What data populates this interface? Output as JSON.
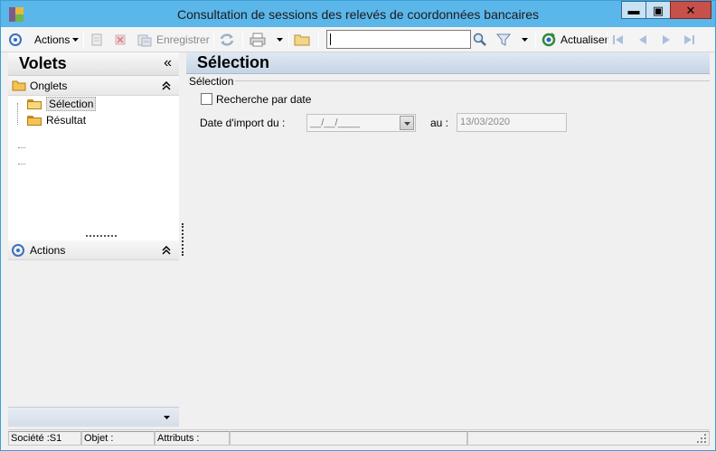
{
  "window": {
    "title": "Consultation de sessions des relevés de coordonnées bancaires",
    "minimize_glyph": "▬",
    "maximize_glyph": "▣",
    "close_glyph": "✕"
  },
  "toolbar": {
    "actions_label": "Actions",
    "save_label": "Enregistrer",
    "refresh_label": "Actualiser",
    "search_value": ""
  },
  "left_panel": {
    "title": "Volets",
    "collapse_glyph": "«",
    "tabs_section": {
      "label": "Onglets",
      "items": [
        {
          "label": "Sélection",
          "selected": true
        },
        {
          "label": "Résultat",
          "selected": false
        }
      ]
    },
    "actions_section": {
      "label": "Actions"
    }
  },
  "main": {
    "title": "Sélection",
    "group_label": "Sélection",
    "search_by_date_label": "Recherche par date",
    "search_by_date_checked": false,
    "import_date_label": "Date d'import du :",
    "import_date_from": "__/__/____",
    "to_label": "au :",
    "import_date_to": "13/03/2020"
  },
  "statusbar": {
    "company": "Société :S1",
    "object": "Objet :",
    "attributes": "Attributs :"
  },
  "colors": {
    "titlebar": "#5bb6ea",
    "close_button": "#c7504a",
    "selection_header": "#c6d4e5"
  }
}
